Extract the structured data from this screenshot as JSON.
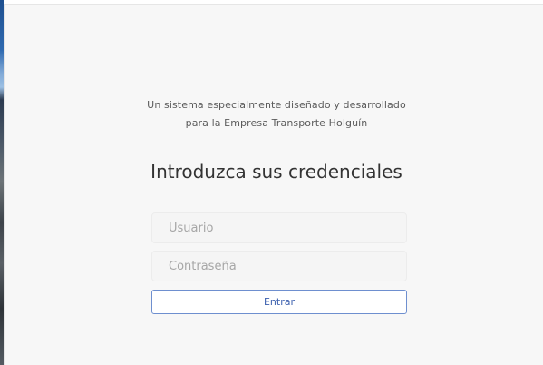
{
  "intro": {
    "tagline": "Un sistema especialmente diseñado y desarrollado para la Empresa Transporte Holguín"
  },
  "login": {
    "heading": "Introduzca sus credenciales",
    "username_placeholder": "Usuario",
    "password_placeholder": "Contraseña",
    "submit_label": "Entrar"
  }
}
